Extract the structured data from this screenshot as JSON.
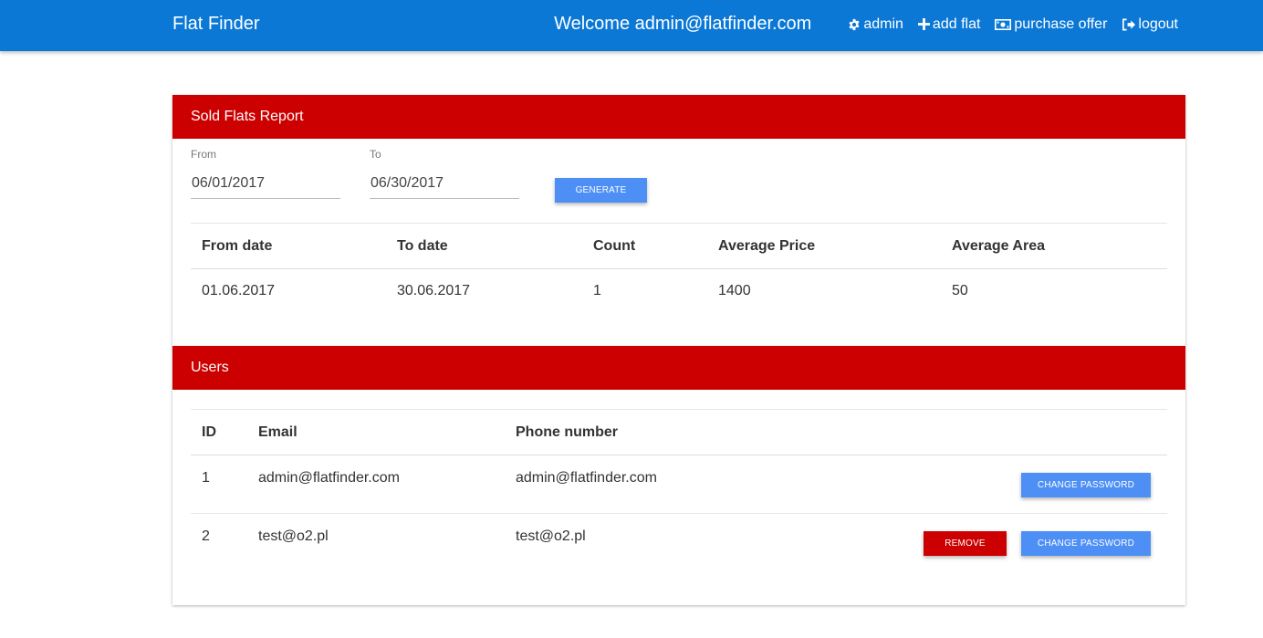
{
  "nav": {
    "brand": "Flat Finder",
    "welcome": "Welcome admin@flatfinder.com",
    "links": [
      {
        "label": "admin",
        "icon": "gear-icon"
      },
      {
        "label": "add flat",
        "icon": "plus-icon"
      },
      {
        "label": "purchase offer",
        "icon": "money-icon"
      },
      {
        "label": "logout",
        "icon": "logout-icon"
      }
    ]
  },
  "report": {
    "title": "Sold Flats Report",
    "from_label": "From",
    "from_value": "06/01/2017",
    "to_label": "To",
    "to_value": "06/30/2017",
    "generate_label": "GENERATE",
    "columns": [
      "From date",
      "To date",
      "Count",
      "Average Price",
      "Average Area"
    ],
    "rows": [
      [
        "01.06.2017",
        "30.06.2017",
        "1",
        "1400",
        "50"
      ]
    ]
  },
  "users": {
    "title": "Users",
    "columns": [
      "ID",
      "Email",
      "Phone number"
    ],
    "remove_label": "REMOVE",
    "change_password_label": "CHANGE PASSWORD",
    "rows": [
      {
        "id": "1",
        "email": "admin@flatfinder.com",
        "phone": "admin@flatfinder.com"
      },
      {
        "id": "2",
        "email": "test@o2.pl",
        "phone": "test@o2.pl"
      }
    ]
  },
  "colors": {
    "navbar": "#0b78d6",
    "header_red": "#cc0000",
    "button_blue": "#4d8ff5"
  }
}
